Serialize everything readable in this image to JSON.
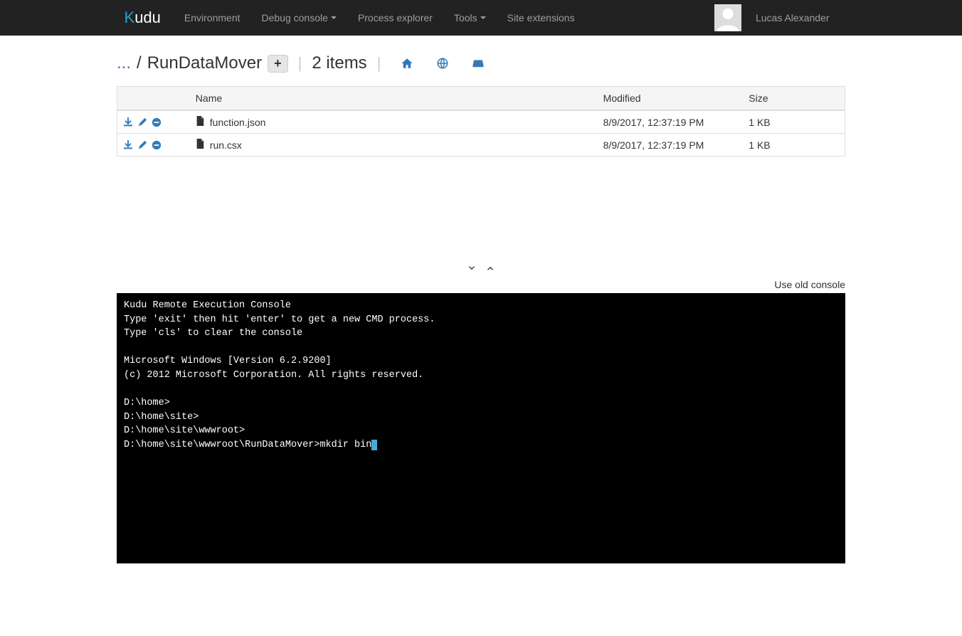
{
  "header": {
    "brand_prefix": "K",
    "brand_rest": "udu",
    "nav": {
      "environment": "Environment",
      "debug_console": "Debug console",
      "process_explorer": "Process explorer",
      "tools": "Tools",
      "site_extensions": "Site extensions"
    },
    "username": "Lucas Alexander"
  },
  "breadcrumb": {
    "ellipsis": "...",
    "separator": "/",
    "current": "RunDataMover",
    "plus": "+",
    "item_count": "2 items"
  },
  "table": {
    "headers": {
      "name": "Name",
      "modified": "Modified",
      "size": "Size"
    },
    "rows": [
      {
        "name": "function.json",
        "modified": "8/9/2017, 12:37:19 PM",
        "size": "1 KB"
      },
      {
        "name": "run.csx",
        "modified": "8/9/2017, 12:37:19 PM",
        "size": "1 KB"
      }
    ]
  },
  "links": {
    "old_console": "Use old console"
  },
  "console": {
    "lines": [
      "Kudu Remote Execution Console",
      "Type 'exit' then hit 'enter' to get a new CMD process.",
      "Type 'cls' to clear the console",
      "",
      "Microsoft Windows [Version 6.2.9200]",
      "(c) 2012 Microsoft Corporation. All rights reserved.",
      "",
      "D:\\home>",
      "D:\\home\\site>",
      "D:\\home\\site\\wwwroot>"
    ],
    "current_prompt": "D:\\home\\site\\wwwroot\\RunDataMover>",
    "current_input": "mkdir bin"
  }
}
